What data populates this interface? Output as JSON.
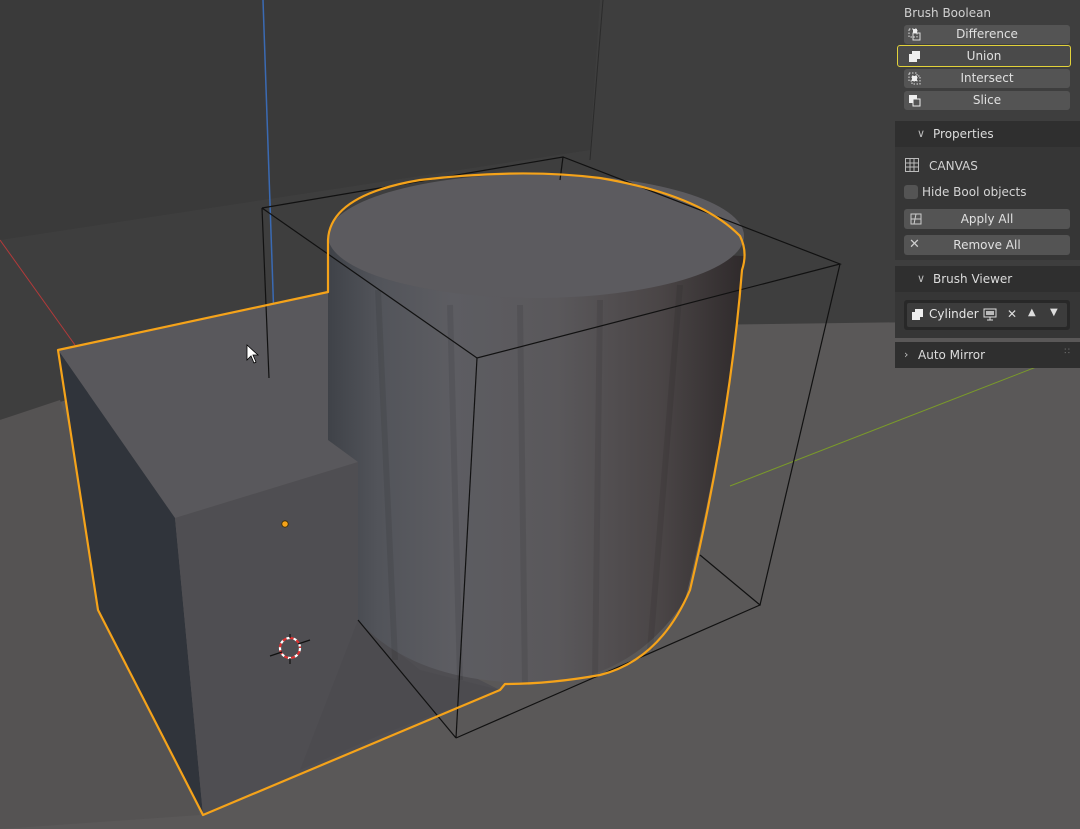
{
  "panel": {
    "brush_boolean_title": "Brush Boolean",
    "operations": [
      {
        "label": "Difference",
        "icon": "difference-icon",
        "active": false
      },
      {
        "label": "Union",
        "icon": "union-icon",
        "active": true
      },
      {
        "label": "Intersect",
        "icon": "intersect-icon",
        "active": false
      },
      {
        "label": "Slice",
        "icon": "slice-icon",
        "active": false
      }
    ],
    "properties": {
      "header": "Properties",
      "canvas_label": "CANVAS",
      "hide_bool_label": "Hide Bool objects",
      "hide_bool_checked": false,
      "apply_all_label": "Apply All",
      "remove_all_label": "Remove All"
    },
    "brush_viewer": {
      "header": "Brush Viewer",
      "item_label": "Cylinder"
    },
    "auto_mirror": {
      "header": "Auto Mirror"
    }
  },
  "colors": {
    "selection_outline": "#f5a31a",
    "active_highlight": "#e2d23a",
    "x_axis": "#b33a3a",
    "y_axis": "#7a9a2a",
    "z_axis": "#3a6ab3"
  }
}
